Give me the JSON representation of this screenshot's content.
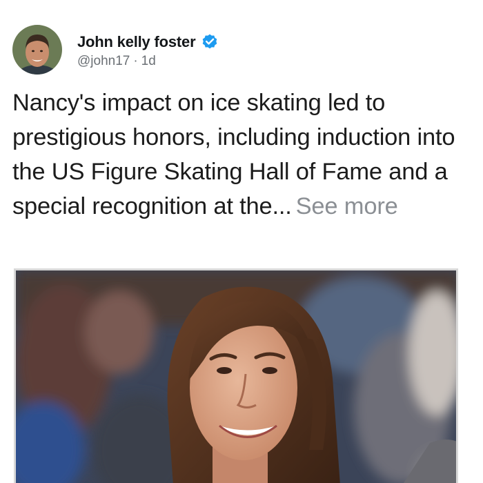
{
  "post": {
    "author": {
      "display_name": "John kelly foster",
      "handle": "@john17",
      "separator": "·",
      "time": "1d",
      "verified_icon": "verified-badge-icon",
      "verified_color": "#1d9bf0"
    },
    "text": "Nancy's impact on ice skating led to prestigious honors, including induction into the US Figure Skating Hall of Fame and a special recognition at the...",
    "see_more_label": "See more",
    "media": {
      "kind": "photo"
    }
  }
}
